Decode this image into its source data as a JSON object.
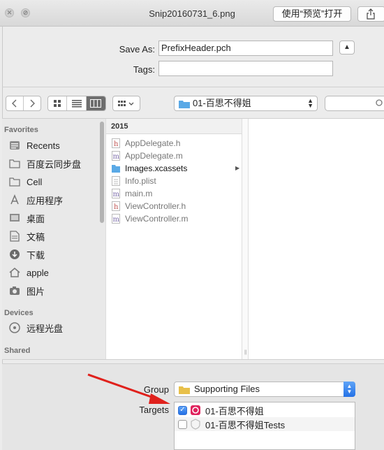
{
  "window": {
    "title": "Snip20160731_6.png",
    "open_with_label": "使用“预览”打开"
  },
  "save": {
    "save_as_label": "Save As:",
    "save_as_value": "PrefixHeader.pch",
    "tags_label": "Tags:",
    "tags_value": ""
  },
  "toolbar": {
    "location": "01-百思不得姐",
    "view_modes": [
      "icon",
      "list",
      "column"
    ],
    "active_view": "column"
  },
  "sidebar": {
    "favorites_header": "Favorites",
    "favorites": [
      {
        "label": "Recents",
        "icon": "recents-icon"
      },
      {
        "label": "百度云同步盘",
        "icon": "folder-icon"
      },
      {
        "label": "Cell",
        "icon": "folder-icon"
      },
      {
        "label": "应用程序",
        "icon": "applications-icon"
      },
      {
        "label": "桌面",
        "icon": "desktop-icon"
      },
      {
        "label": "文稿",
        "icon": "documents-icon"
      },
      {
        "label": "下载",
        "icon": "download-icon"
      },
      {
        "label": "apple",
        "icon": "home-icon"
      },
      {
        "label": "图片",
        "icon": "pictures-icon"
      }
    ],
    "devices_header": "Devices",
    "devices": [
      {
        "label": "远程光盘",
        "icon": "remote-disc-icon"
      }
    ],
    "shared_header": "Shared"
  },
  "browser": {
    "column_header": "2015",
    "files": [
      {
        "name": "AppDelegate.h",
        "kind": "h"
      },
      {
        "name": "AppDelegate.m",
        "kind": "m"
      },
      {
        "name": "Images.xcassets",
        "kind": "folder"
      },
      {
        "name": "Info.plist",
        "kind": "plist"
      },
      {
        "name": "main.m",
        "kind": "m"
      },
      {
        "name": "ViewController.h",
        "kind": "h"
      },
      {
        "name": "ViewController.m",
        "kind": "m"
      }
    ]
  },
  "options": {
    "group_label": "Group",
    "group_value": "Supporting Files",
    "targets_label": "Targets",
    "targets": [
      {
        "name": "01-百思不得姐",
        "checked": true
      },
      {
        "name": "01-百思不得姐Tests",
        "checked": false
      }
    ]
  },
  "colors": {
    "accent": "#2471e6",
    "folder_blue": "#5aa9e6",
    "folder_yellow": "#e8c04a",
    "annotation_arrow": "#e0211c"
  }
}
